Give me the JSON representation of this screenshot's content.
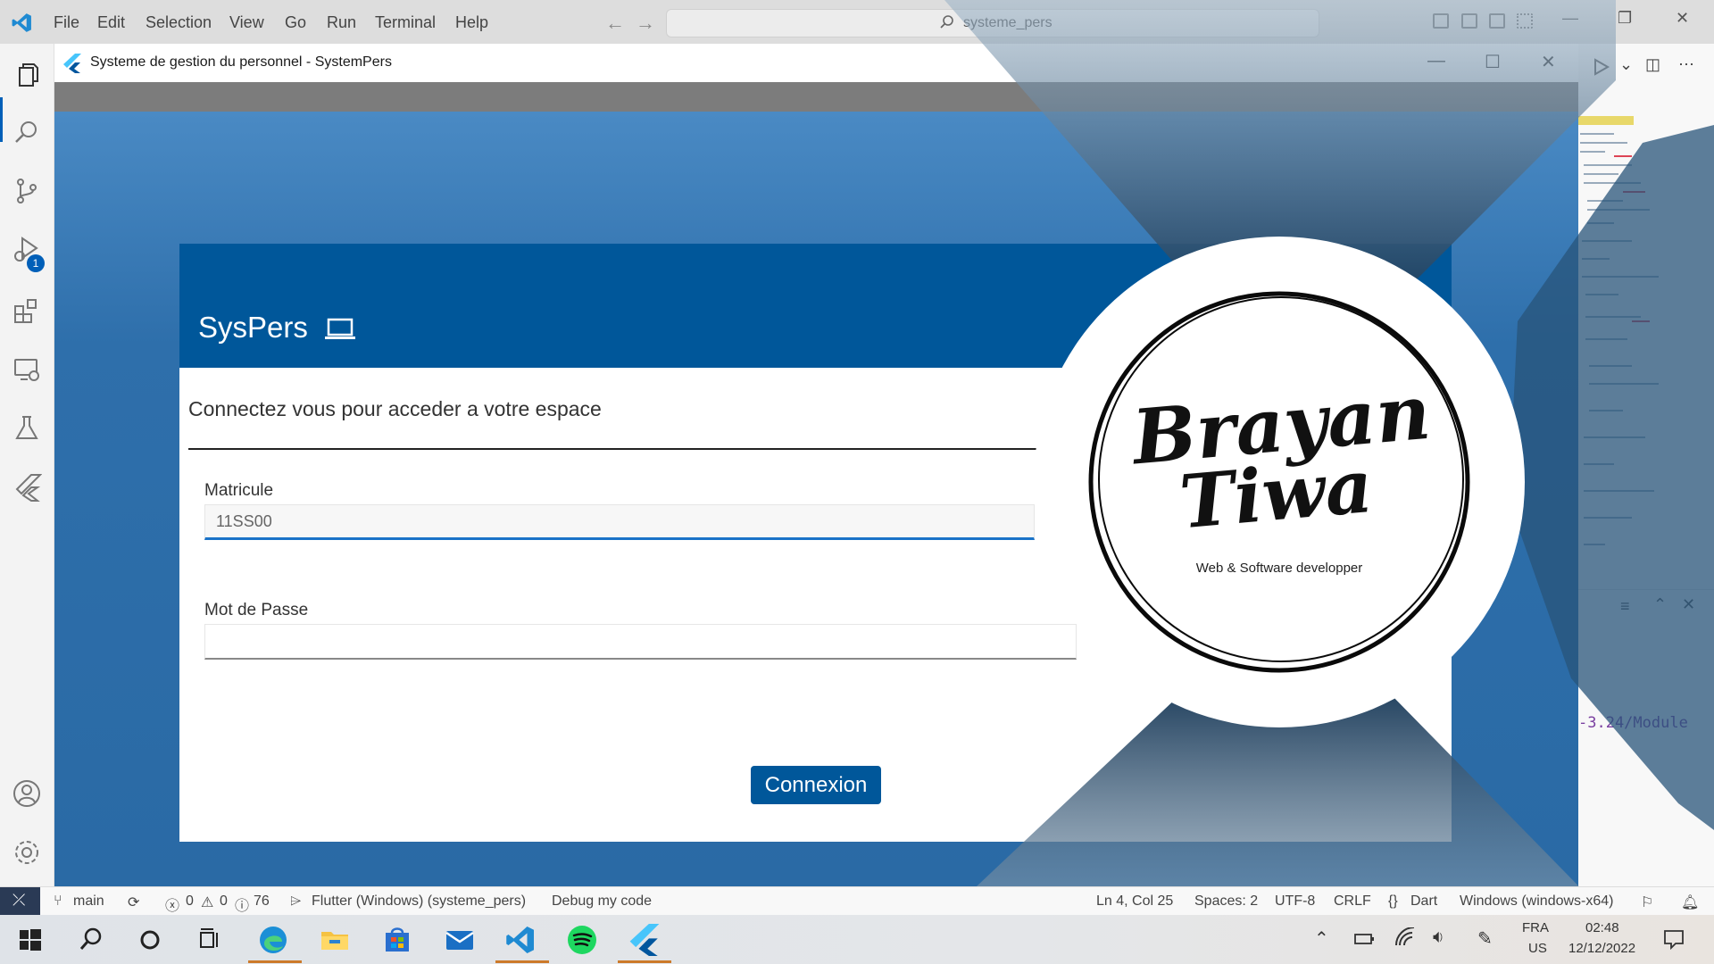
{
  "menubar": {
    "items": [
      "File",
      "Edit",
      "Selection",
      "View",
      "Go",
      "Run",
      "Terminal",
      "Help"
    ],
    "search_text": "systeme_pers"
  },
  "activitybar": {
    "icons": [
      "explorer-icon",
      "search-icon",
      "source-control-icon",
      "run-debug-icon",
      "extensions-icon",
      "remote-explorer-icon",
      "testing-icon",
      "flutter-icon",
      "account-icon",
      "settings-icon"
    ],
    "debug_badge": "1"
  },
  "app": {
    "window_title": "Systeme de gestion du personnel - SystemPers",
    "brand": "SysPers",
    "subtitle": "Connectez vous pour acceder a votre espace",
    "matricule_label": "Matricule",
    "matricule_value": "11SS00",
    "password_label": "Mot de Passe",
    "password_value": "",
    "login_button": "Connexion"
  },
  "watermark": {
    "name_line1": "Brayan",
    "name_line2": "Tiwa",
    "tagline": "Web & Software developper"
  },
  "terminal": {
    "visible_text": "-3.24/Module"
  },
  "statusbar": {
    "branch": "main",
    "problems": "0",
    "warnings": "0",
    "info": "76",
    "device": "Flutter (Windows) (systeme_pers)",
    "debug_mode": "Debug my code",
    "cursor": "Ln 4, Col 25",
    "spaces": "Spaces: 2",
    "encoding": "UTF-8",
    "eol": "CRLF",
    "language": "Dart",
    "platform": "Windows (windows-x64)"
  },
  "taskbar": {
    "apps": [
      "start-icon",
      "search-icon",
      "cortana-icon",
      "task-view-icon",
      "edge-icon",
      "file-explorer-icon",
      "store-icon",
      "mail-icon",
      "vscode-icon",
      "spotify-icon",
      "flutter-app-icon"
    ],
    "lang_line1": "FRA",
    "lang_line2": "US",
    "time": "02:48",
    "date": "12/12/2022"
  },
  "colors": {
    "app_header": "#00579a",
    "accent": "#005fb8",
    "button": "#00579a"
  }
}
